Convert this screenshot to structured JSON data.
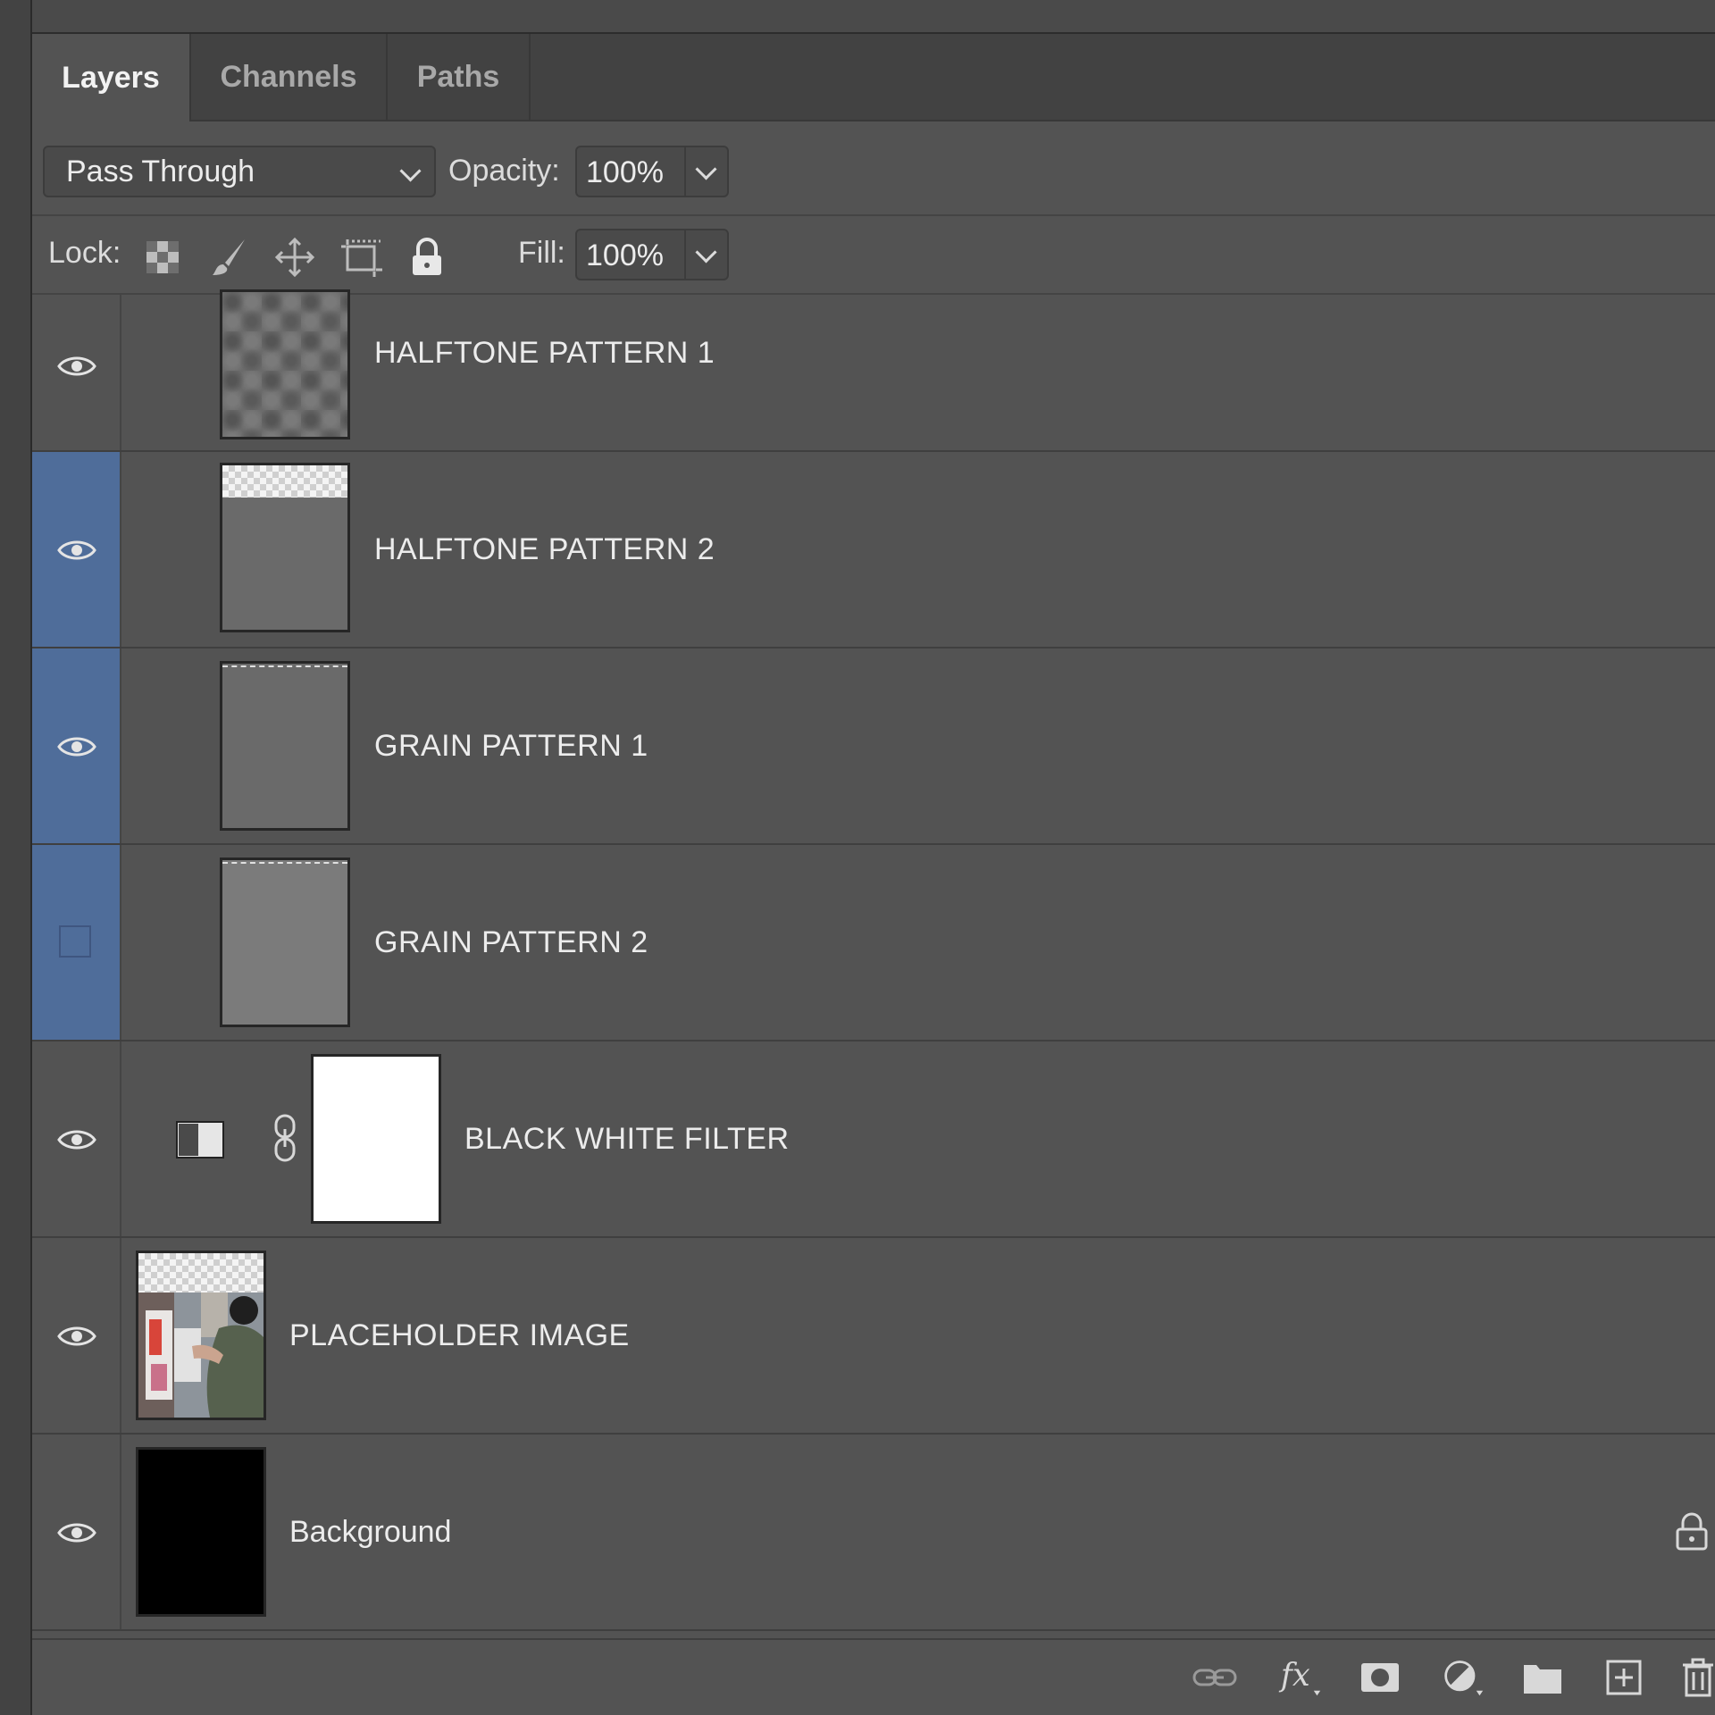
{
  "tabs": [
    {
      "label": "Layers",
      "active": true
    },
    {
      "label": "Channels",
      "active": false
    },
    {
      "label": "Paths",
      "active": false
    }
  ],
  "blend_mode": {
    "value": "Pass Through"
  },
  "opacity": {
    "label": "Opacity:",
    "value": "100%"
  },
  "lock": {
    "label": "Lock:",
    "icons": [
      "lock-transparent-pixels-icon",
      "lock-image-pixels-icon",
      "lock-position-icon",
      "lock-artboard-icon",
      "lock-all-icon"
    ]
  },
  "fill": {
    "label": "Fill:",
    "value": "100%"
  },
  "layers": [
    {
      "name": "HALFTONE PATTERN 1",
      "visible": true,
      "selected": false
    },
    {
      "name": "HALFTONE PATTERN 2",
      "visible": true,
      "selected": true
    },
    {
      "name": "GRAIN PATTERN 1",
      "visible": true,
      "selected": true
    },
    {
      "name": "GRAIN PATTERN 2",
      "visible": false,
      "selected": true
    },
    {
      "name": "BLACK WHITE FILTER",
      "visible": true,
      "selected": false
    },
    {
      "name": "PLACEHOLDER IMAGE",
      "visible": true,
      "selected": false
    },
    {
      "name": "Background",
      "visible": true,
      "selected": false,
      "locked": true
    }
  ],
  "footer_icons": [
    "link-layers-icon",
    "fx-icon",
    "add-mask-icon",
    "adjustment-layer-icon",
    "new-group-icon",
    "new-layer-icon",
    "delete-layer-icon"
  ],
  "colors": {
    "panel": "#535353",
    "selected": "#4f6d9a",
    "tabbar": "#424242"
  }
}
